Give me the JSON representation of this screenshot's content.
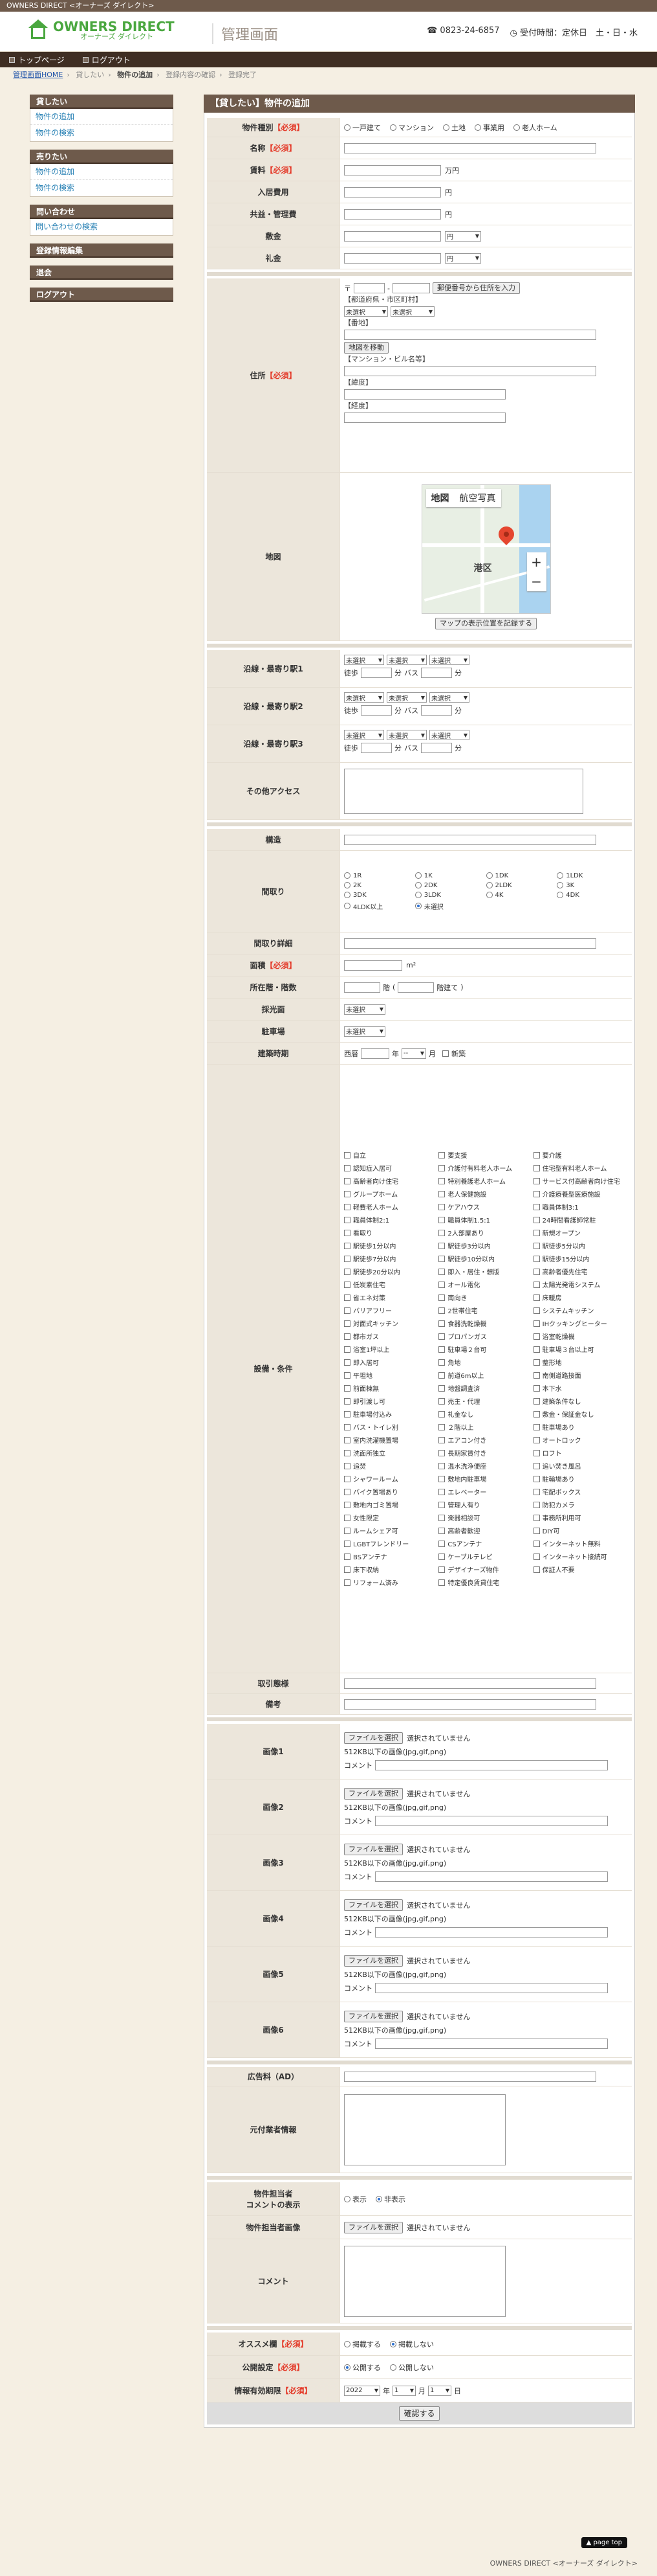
{
  "brand": {
    "topstrip": "OWNERS DIRECT <オーナーズ ダイレクト>",
    "logo_en": "OWNERS DIRECT",
    "logo_ja": "オーナーズ ダイレクト",
    "site_title": "管理画面",
    "phone": "☎ 0823-24-6857",
    "hours": "◷ 受付時間：定休日　土・日・水"
  },
  "nav": {
    "top": "トップページ",
    "logout": "ログアウト"
  },
  "breadcrumb": {
    "home": "管理画面HOME",
    "b1": "貸したい",
    "b2": "物件の追加",
    "b3": "登録内容の確認",
    "b4": "登録完了"
  },
  "sidebar": {
    "lend_h": "貸したい",
    "lend_add": "物件の追加",
    "lend_search": "物件の検索",
    "sell_h": "売りたい",
    "sell_add": "物件の追加",
    "sell_search": "物件の検索",
    "inq_h": "問い合わせ",
    "inq_search": "問い合わせの検索",
    "reg": "登録情報編集",
    "withdraw": "退会",
    "logout": "ログアウト"
  },
  "main_title": "【貸したい】物件の追加",
  "labels": {
    "req": "【必須】",
    "type": "物件種別",
    "name": "名称",
    "rent": "賃料",
    "move_fee": "入居費用",
    "common_fee": "共益・管理費",
    "deposit": "敷金",
    "key_money": "礼金",
    "address": "住所",
    "map": "地図",
    "line1": "沿線・最寄り駅1",
    "line2": "沿線・最寄り駅2",
    "line3": "沿線・最寄り駅3",
    "other_access": "その他アクセス",
    "structure": "構造",
    "layout": "間取り",
    "layout_detail": "間取り詳細",
    "area": "面積",
    "floor": "所在階・階数",
    "light": "採光面",
    "parking": "駐車場",
    "built": "建築時期",
    "facilities": "設備・条件",
    "deal": "取引態様",
    "note": "備考",
    "image1": "画像1",
    "image2": "画像2",
    "image3": "画像3",
    "image4": "画像4",
    "image5": "画像5",
    "image6": "画像6",
    "ad": "広告料（AD）",
    "ref_info": "元付業者情報",
    "staff_comment_1": "物件担当者",
    "staff_comment_2": "コメントの表示",
    "staff_image": "物件担当者画像",
    "comment": "コメント",
    "recommend": "オススメ欄",
    "publish": "公開設定",
    "expire": "情報有効期限"
  },
  "type_opts": [
    "一戸建て",
    "マンション",
    "土地",
    "事業用",
    "老人ホーム"
  ],
  "units": {
    "yen_man": "万円",
    "yen": "円",
    "sqm": "m²",
    "floor": "階",
    "total_floor": "階建て",
    "month": "月",
    "year": "年",
    "day": "日",
    "walk": "徒歩",
    "min": "分",
    "bus": "バス"
  },
  "select": {
    "yen": "円",
    "unsel": "未選択",
    "era": "西暦",
    "dash": "--",
    "y2022": "2022",
    "m1": "1",
    "d1": "1"
  },
  "address": {
    "zip_btn": "郵便番号から住所を入力",
    "zip_mark": "〒",
    "pref": "【都道府県・市区町村】",
    "number": "【番地】",
    "bldg": "【マンション・ビル名等】",
    "map_btn": "地図を移動",
    "lat": "【緯度】",
    "lng": "【経度】"
  },
  "map": {
    "tab1": "地図",
    "tab2": "航空写真",
    "area": "港区",
    "record_btn": "マップの表示位置を記録する"
  },
  "layout_opts": [
    "1R",
    "1K",
    "1DK",
    "1LDK",
    "2K",
    "2DK",
    "2LDK",
    "3K",
    "3DK",
    "3LDK",
    "4K",
    "4DK",
    "4LDK以上",
    "未選択"
  ],
  "built_new": "新築",
  "facilities": [
    "自立",
    "要支援",
    "要介護",
    "認知症入居可",
    "介護付有料老人ホーム",
    "住宅型有料老人ホーム",
    "高齢者向け住宅",
    "特別養護老人ホーム",
    "サービス付高齢者向け住宅",
    "グループホーム",
    "老人保健施設",
    "介護療養型医療施設",
    "軽費老人ホーム",
    "ケアハウス",
    "職員体制3:1",
    "職員体制2:1",
    "職員体制1.5:1",
    "24時間看護師常駐",
    "看取り",
    "2人部屋あり",
    "新規オープン",
    "駅徒歩1分以内",
    "駅徒歩3分以内",
    "駅徒歩5分以内",
    "駅徒歩7分以内",
    "駅徒歩10分以内",
    "駅徒歩15分以内",
    "駅徒歩20分以内",
    "即入・居住・想版",
    "高齢者優先住宅",
    "低炭素住宅",
    "オール電化",
    "太陽光発電システム",
    "省エネ対策",
    "南向き",
    "床暖房",
    "バリアフリー",
    "2世帯住宅",
    "システムキッチン",
    "対面式キッチン",
    "食器洗乾燥機",
    "IHクッキングヒーター",
    "都市ガス",
    "プロパンガス",
    "浴室乾燥機",
    "浴室1坪以上",
    "駐車場２台可",
    "駐車場３台以上可",
    "即入居可",
    "角地",
    "整形地",
    "平坦地",
    "前道6m以上",
    "南側道路接面",
    "前面棟無",
    "地盤調査済",
    "本下水",
    "即引渡し可",
    "売主・代理",
    "建築条件なし",
    "駐車場付込み",
    "礼金なし",
    "敷金・保証金なし",
    "バス・トイレ別",
    "２階以上",
    "駐車場あり",
    "室内洗濯機置場",
    "エアコン付き",
    "オートロック",
    "洗面所独立",
    "長期家賃付き",
    "ロフト",
    "追焚",
    "温水洗浄便座",
    "追い焚き風呂",
    "シャワールーム",
    "敷地内駐車場",
    "駐輪場あり",
    "バイク置場あり",
    "エレベーター",
    "宅配ボックス",
    "敷地内ゴミ置場",
    "管理人有り",
    "防犯カメラ",
    "女性限定",
    "楽器相談可",
    "事務所利用可",
    "ルームシェア可",
    "高齢者歓迎",
    "DIY可",
    "LGBTフレンドリー",
    "CSアンテナ",
    "インターネット無料",
    "BSアンテナ",
    "ケーブルテレビ",
    "インターネット接続可",
    "床下収納",
    "デザイナーズ物件",
    "保証人不要",
    "リフォーム済み",
    "特定優良賃貸住宅"
  ],
  "file": {
    "btn": "ファイルを選択",
    "none": "選択されていません",
    "hint": "512KB以下の画像(jpg,gif,png)",
    "comment": "コメント"
  },
  "staff_disp": {
    "show": "表示",
    "hide": "非表示"
  },
  "recommend_opts": {
    "on": "掲載する",
    "off": "掲載しない"
  },
  "publish_opts": {
    "on": "公開する",
    "off": "公開しない"
  },
  "submit": "確認する",
  "pagetop": "▲ page top",
  "footer": "OWNERS DIRECT <オーナーズ ダイレクト>"
}
